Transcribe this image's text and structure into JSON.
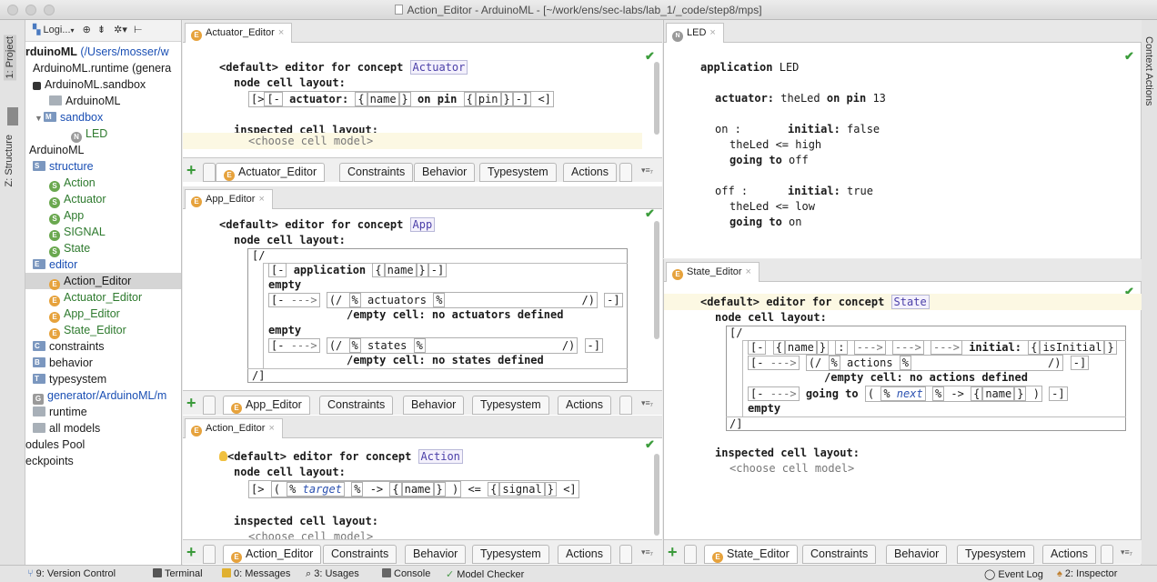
{
  "window": {
    "title": "Action_Editor - ArduinoML - [~/work/ens/sec-labs/lab_1/_code/step8/mps]"
  },
  "left_strip": {
    "project": "1: Project",
    "structure": "Z: Structure"
  },
  "right_strip": {
    "context_actions": "Context Actions"
  },
  "tree": {
    "toolbar_label": "Logi...",
    "project_name": "rduinoML",
    "project_path": "(/Users/mosser/w",
    "runtime": "ArduinoML.runtime (genera",
    "sandbox_solution": "ArduinoML.sandbox",
    "arduinoml": "ArduinoML",
    "sandbox": "sandbox",
    "led": "LED",
    "language": "ArduinoML",
    "structure": "structure",
    "structure_items": [
      "Action",
      "Actuator",
      "App",
      "SIGNAL",
      "State"
    ],
    "editor": "editor",
    "editor_items": [
      "Action_Editor",
      "Actuator_Editor",
      "App_Editor",
      "State_Editor"
    ],
    "constraints": "constraints",
    "behavior": "behavior",
    "typesystem": "typesystem",
    "generator": "generator/ArduinoML/m",
    "runtime_folder": "runtime",
    "all_models": "all models",
    "modules_pool": "odules Pool",
    "checkpoints": "eckpoints"
  },
  "aspect_tabs": {
    "constraints": "Constraints",
    "behavior": "Behavior",
    "typesystem": "Typesystem",
    "actions": "Actions",
    "more": "▾≡₇"
  },
  "actuator_editor": {
    "tab": "Actuator_Editor",
    "default": "<default>",
    "editor_for_concept": "editor for concept",
    "concept": "Actuator",
    "node_cell_layout": "node cell layout:",
    "line1": [
      "[>",
      "[-",
      "actuator:",
      "{",
      "name",
      "}",
      "on pin",
      "{",
      "pin",
      "}",
      "-]",
      "<]"
    ],
    "inspected": "inspected cell layout:",
    "choose": "<choose cell model>",
    "bottom_tab": "Actuator_Editor"
  },
  "app_editor": {
    "tab": "App_Editor",
    "default": "<default>",
    "editor_for_concept": "editor for concept",
    "concept": "App",
    "node_cell_layout": "node cell layout:",
    "open": "[/",
    "app_line": [
      "[-",
      "application",
      "{",
      "name",
      "}",
      "-]"
    ],
    "empty1": "empty",
    "act_line": [
      "[-",
      "--->",
      "(/",
      "%",
      "actuators",
      "%",
      "/)",
      "-]"
    ],
    "act_empty": "/empty cell: no actuators defined",
    "empty2": "empty",
    "st_line": [
      "[-",
      "--->",
      "(/",
      "%",
      "states",
      "%",
      "/)",
      "-]"
    ],
    "st_empty": "/empty cell: no states defined",
    "close": "/]",
    "bottom_tab": "App_Editor"
  },
  "action_editor": {
    "tab": "Action_Editor",
    "default": "<default>",
    "editor_for_concept": "editor for concept",
    "concept": "Action",
    "node_cell_layout": "node cell layout:",
    "line1": [
      "[>",
      "(",
      "%",
      "target",
      "%",
      "->",
      "{",
      "name",
      "}",
      ")",
      "<=",
      "{",
      "signal",
      "}",
      "<]"
    ],
    "inspected": "inspected cell layout:",
    "choose": "<choose cell model>",
    "bottom_tab": "Action_Editor"
  },
  "led": {
    "tab": "LED",
    "application": "application",
    "app_name": "LED",
    "actuator_kw": "actuator:",
    "actuator_name": "theLed",
    "on_pin": "on pin",
    "pin": "13",
    "on_state": "on :",
    "initial_kw": "initial:",
    "on_initial": "false",
    "on_action": "theLed <= high",
    "going_to": "going to",
    "on_next": "off",
    "off_state": "off :",
    "off_initial": "true",
    "off_action": "theLed <= low",
    "off_next": "on"
  },
  "state_editor": {
    "tab": "State_Editor",
    "default": "<default>",
    "editor_for_concept": "editor for concept",
    "concept": "State",
    "node_cell_layout": "node cell layout:",
    "open": "[/",
    "line1": [
      "[-",
      "{",
      "name",
      "}",
      ":",
      "--->",
      "--->",
      "--->",
      "initial:",
      "{",
      "isInitial",
      "}",
      "-"
    ],
    "line2": [
      "[-",
      "--->",
      "(/",
      "%",
      "actions",
      "%",
      "/)",
      "-]"
    ],
    "empty_cell": "/empty cell: no actions defined",
    "line3": [
      "[-",
      "--->",
      "going to",
      "(",
      "%",
      "next",
      "%",
      "->",
      "{",
      "name",
      "}",
      ")",
      "-]"
    ],
    "empty": "empty",
    "close": "/]",
    "inspected": "inspected cell layout:",
    "choose": "<choose cell model>",
    "bottom_tab": "State_Editor"
  },
  "status": {
    "version_control": "9: Version Control",
    "terminal": "Terminal",
    "messages": "0: Messages",
    "usages": "3: Usages",
    "console": "Console",
    "model_checker": "Model Checker",
    "event_log": "Event Log",
    "inspector": "2: Inspector"
  },
  "colors": {
    "accent_blue": "#1a4fb4",
    "check_green": "#3c9d3c",
    "editor_badge": "#e6a23c",
    "structure_badge": "#6aa84f"
  }
}
